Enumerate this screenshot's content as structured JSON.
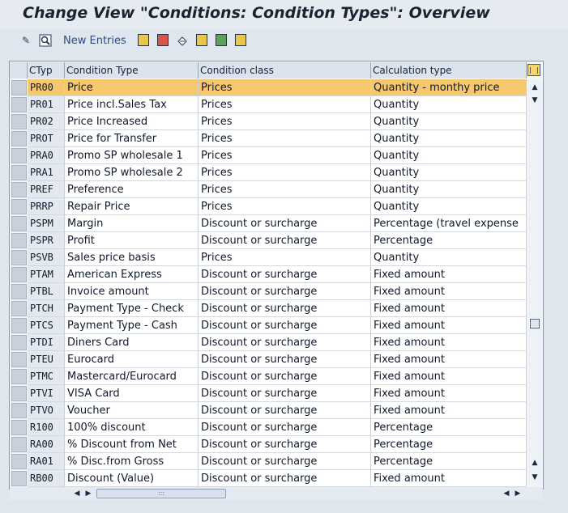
{
  "window": {
    "title": "Change View \"Conditions: Condition Types\": Overview"
  },
  "toolbar": {
    "new_entries_label": "New Entries",
    "icons": [
      "pencil-glasses-icon",
      "search-icon",
      "copy-icon",
      "delete-icon",
      "undo-icon",
      "select-all-icon",
      "select-block-icon",
      "deselect-all-icon"
    ]
  },
  "table": {
    "columns": [
      "CTyp",
      "Condition Type",
      "Condition class",
      "Calculation type"
    ],
    "highlighted_row": 0,
    "rows": [
      {
        "ctyp": "PR00",
        "type": "Price",
        "class": "Prices",
        "calc": "Quantity - monthy price"
      },
      {
        "ctyp": "PR01",
        "type": "Price incl.Sales Tax",
        "class": "Prices",
        "calc": "Quantity"
      },
      {
        "ctyp": "PR02",
        "type": "Price Increased",
        "class": "Prices",
        "calc": "Quantity"
      },
      {
        "ctyp": "PROT",
        "type": "Price    for Transfer",
        "class": "Prices",
        "calc": "Quantity"
      },
      {
        "ctyp": "PRA0",
        "type": "Promo SP wholesale 1",
        "class": "Prices",
        "calc": "Quantity"
      },
      {
        "ctyp": "PRA1",
        "type": "Promo SP wholesale 2",
        "class": "Prices",
        "calc": "Quantity"
      },
      {
        "ctyp": "PREF",
        "type": "Preference",
        "class": "Prices",
        "calc": "Quantity"
      },
      {
        "ctyp": "PRRP",
        "type": "Repair Price",
        "class": "Prices",
        "calc": "Quantity"
      },
      {
        "ctyp": "PSPM",
        "type": "Margin",
        "class": "Discount or surcharge",
        "calc": "Percentage (travel expense"
      },
      {
        "ctyp": "PSPR",
        "type": "Profit",
        "class": "Discount or surcharge",
        "calc": "Percentage"
      },
      {
        "ctyp": "PSVB",
        "type": "Sales price basis",
        "class": "Prices",
        "calc": "Quantity"
      },
      {
        "ctyp": "PTAM",
        "type": "American Express",
        "class": "Discount or surcharge",
        "calc": "Fixed amount"
      },
      {
        "ctyp": "PTBL",
        "type": "Invoice amount",
        "class": "Discount or surcharge",
        "calc": "Fixed amount"
      },
      {
        "ctyp": "PTCH",
        "type": "Payment Type - Check",
        "class": "Discount or surcharge",
        "calc": "Fixed amount"
      },
      {
        "ctyp": "PTCS",
        "type": "Payment Type - Cash",
        "class": "Discount or surcharge",
        "calc": "Fixed amount"
      },
      {
        "ctyp": "PTDI",
        "type": "Diners Card",
        "class": "Discount or surcharge",
        "calc": "Fixed amount"
      },
      {
        "ctyp": "PTEU",
        "type": "Eurocard",
        "class": "Discount or surcharge",
        "calc": "Fixed amount"
      },
      {
        "ctyp": "PTMC",
        "type": "Mastercard/Eurocard",
        "class": "Discount or surcharge",
        "calc": "Fixed amount"
      },
      {
        "ctyp": "PTVI",
        "type": "VISA Card",
        "class": "Discount or surcharge",
        "calc": "Fixed amount"
      },
      {
        "ctyp": "PTVO",
        "type": "Voucher",
        "class": "Discount or surcharge",
        "calc": "Fixed amount"
      },
      {
        "ctyp": "R100",
        "type": "100% discount",
        "class": "Discount or surcharge",
        "calc": "Percentage"
      },
      {
        "ctyp": "RA00",
        "type": "% Discount from Net",
        "class": "Discount or surcharge",
        "calc": "Percentage"
      },
      {
        "ctyp": "RA01",
        "type": "% Disc.from Gross",
        "class": "Discount or surcharge",
        "calc": "Percentage"
      },
      {
        "ctyp": "RB00",
        "type": "Discount (Value)",
        "class": "Discount or surcharge",
        "calc": "Fixed amount"
      }
    ]
  },
  "scrollbars": {
    "up_glyph": "▲",
    "down_glyph": "▼",
    "left_glyph": "◀",
    "right_glyph": "▶",
    "grip": ":::"
  }
}
